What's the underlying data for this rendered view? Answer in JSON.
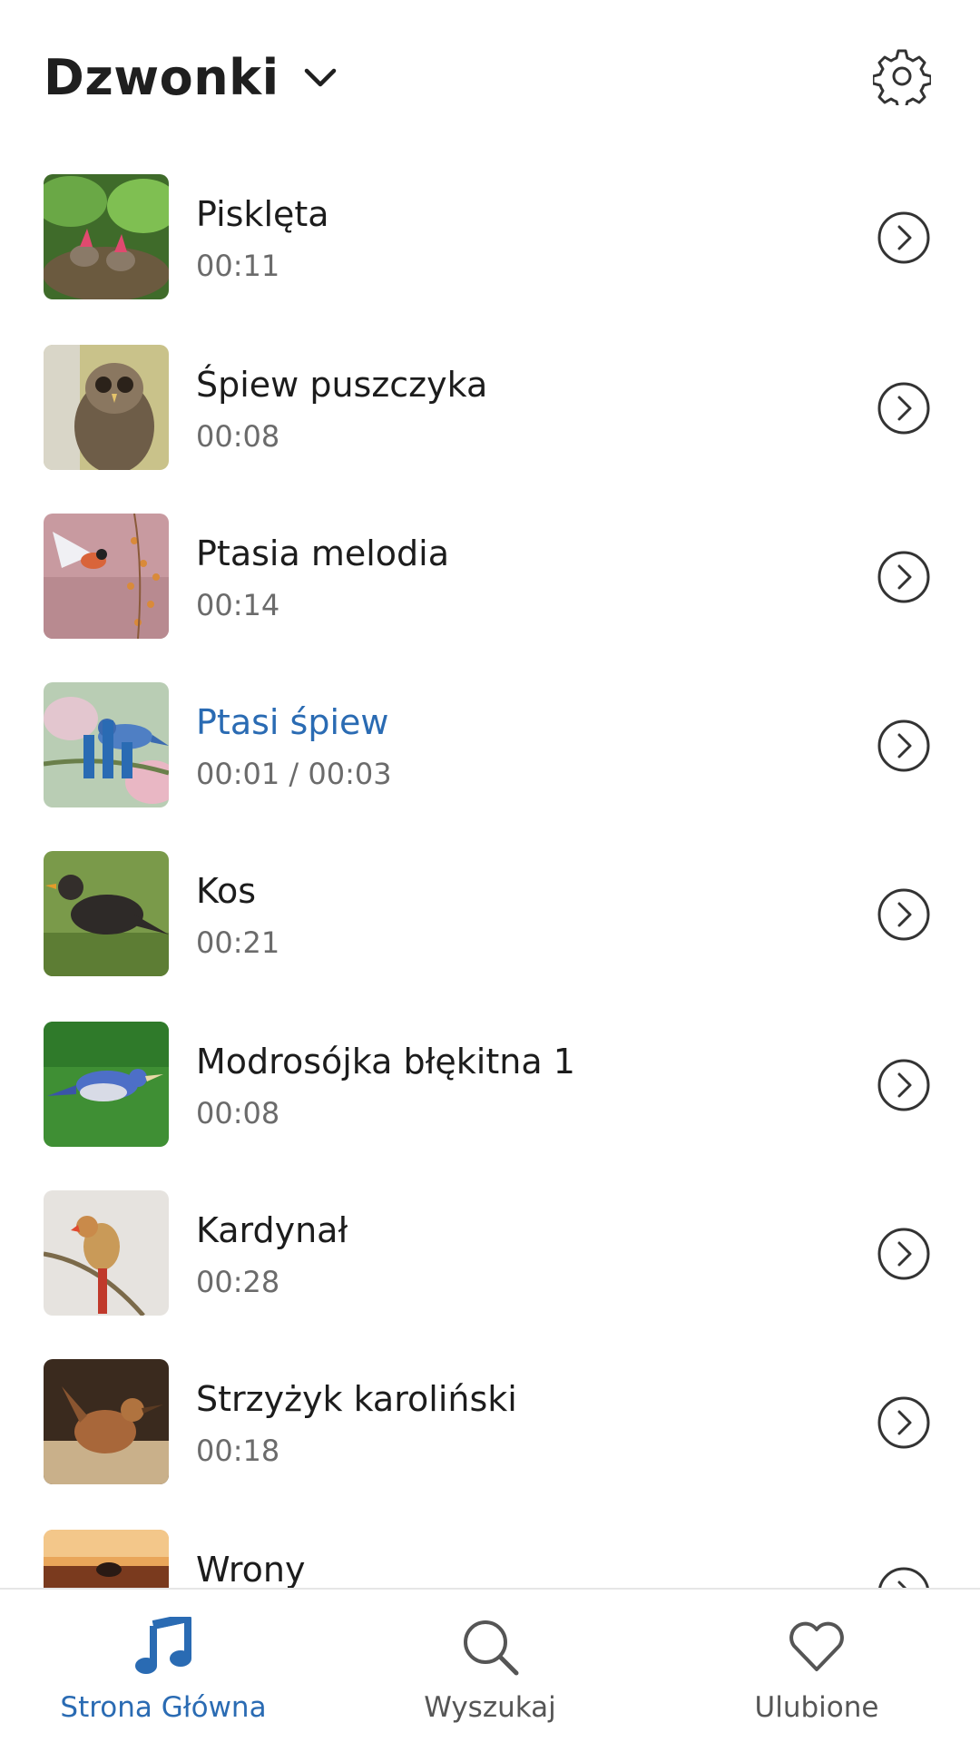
{
  "header": {
    "title": "Dzwonki",
    "dropdown_icon": "chevron-down-icon",
    "settings_icon": "gear-icon"
  },
  "items": [
    {
      "title": "Pisklęta",
      "time": "00:11",
      "thumb": "bird-nestlings-photo"
    },
    {
      "title": "Śpiew puszczyka",
      "time": "00:08",
      "thumb": "owl-photo"
    },
    {
      "title": "Ptasia melodia",
      "time": "00:14",
      "thumb": "flying-bird-photo"
    },
    {
      "title": "Ptasi śpiew",
      "time": "00:01 / 00:03",
      "thumb": "blue-bird-photo",
      "playing": true
    },
    {
      "title": "Kos",
      "time": "00:21",
      "thumb": "blackbird-photo"
    },
    {
      "title": "Modrosójka błękitna 1",
      "time": "00:08",
      "thumb": "blue-jay-photo"
    },
    {
      "title": "Kardynał",
      "time": "00:28",
      "thumb": "cardinal-photo"
    },
    {
      "title": "Strzyżyk karoliński",
      "time": "00:18",
      "thumb": "wren-photo"
    },
    {
      "title": "Wrony",
      "time": "",
      "thumb": "crow-photo"
    }
  ],
  "nav": {
    "home": "Strona Główna",
    "search": "Wyszukaj",
    "favorites": "Ulubione"
  },
  "colors": {
    "accent": "#2a6bb3",
    "text": "#1c1c1c",
    "secondary_text": "#6b6b6b"
  }
}
